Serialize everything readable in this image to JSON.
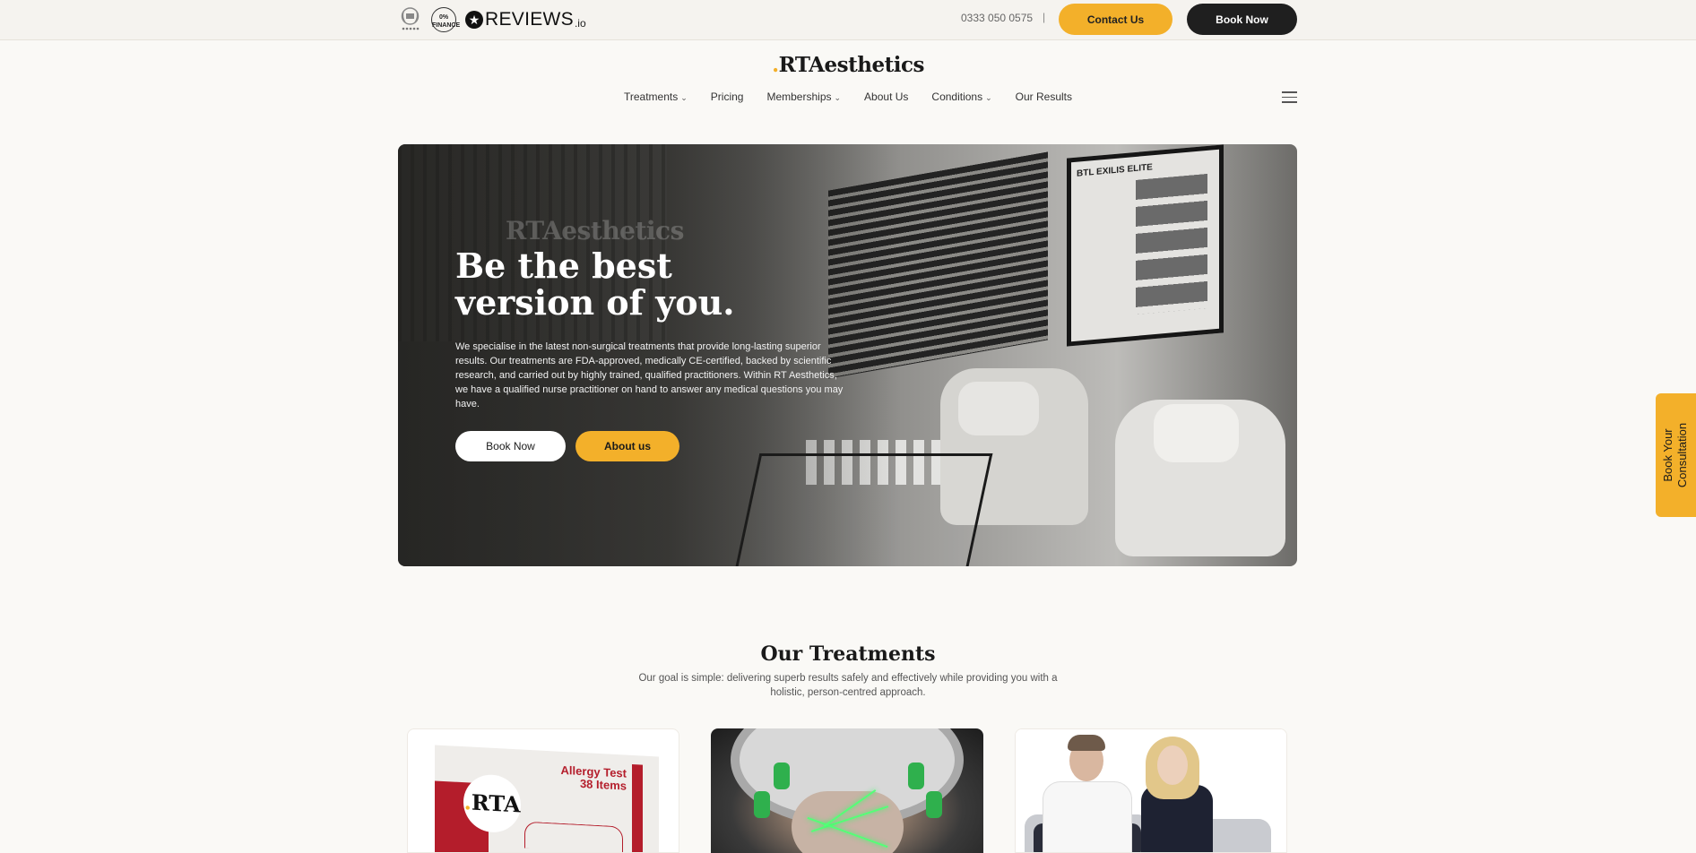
{
  "topbar": {
    "award_icon": "laurel-award-icon",
    "finance_badge": "0% FINANCE",
    "reviews_brand": "REVIEWS",
    "reviews_suffix": ".io",
    "reviews_icon": "star-icon",
    "phone": "0333 050 0575",
    "separator": "|",
    "contact_label": "Contact Us",
    "book_label": "Book Now"
  },
  "header": {
    "logo_mark": ".",
    "logo_text": "RTAesthetics",
    "menu_icon": "hamburger-menu-icon"
  },
  "nav": {
    "items": [
      {
        "label": "Treatments",
        "has_dropdown": true
      },
      {
        "label": "Pricing",
        "has_dropdown": false
      },
      {
        "label": "Memberships",
        "has_dropdown": true
      },
      {
        "label": "About Us",
        "has_dropdown": false
      },
      {
        "label": "Conditions",
        "has_dropdown": true
      },
      {
        "label": "Our Results",
        "has_dropdown": false
      }
    ],
    "chevron": "⌄"
  },
  "hero": {
    "watermark": "RTAesthetics",
    "poster_title": "BTL EXILIS ELITE",
    "title_line1": "Be the best",
    "title_line2": "version of you.",
    "description": "We specialise in the latest non-surgical treatments that provide long-lasting superior results. Our treatments are FDA-approved, medically CE-certified, backed by scientific research, and carried out by highly trained, qualified practitioners. Within RT Aesthetics, we have a qualified nurse practitioner on hand to answer any medical questions you may have.",
    "book_label": "Book Now",
    "about_label": "About us"
  },
  "side_tab": {
    "line1": "Book Your",
    "line2": "Consultation"
  },
  "treatments": {
    "title": "Our Treatments",
    "subtitle": "Our goal is simple: delivering superb results safely and effectively while providing you with a holistic, person-centred approach.",
    "cards": [
      {
        "box_title_line1": "Allergy Test",
        "box_title_line2": "38 Items",
        "box_logo": "RTA"
      },
      {
        "image": "laser-helmet-treatment"
      },
      {
        "image": "practitioners-portrait"
      }
    ]
  },
  "colors": {
    "accent": "#f3b02a",
    "dark": "#1f1f1f",
    "background": "#faf9f6"
  }
}
